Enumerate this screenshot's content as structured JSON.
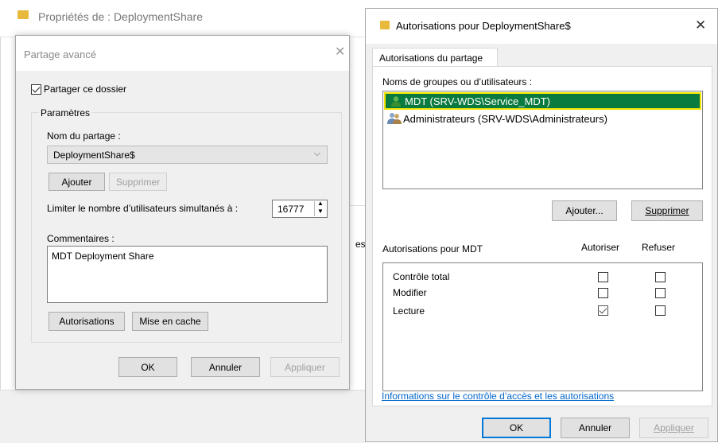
{
  "bg_window": {
    "title": "Propriétés de : DeploymentShare",
    "fragment_text": "es"
  },
  "advanced_share": {
    "title": "Partage avancé",
    "share_checkbox_label": "Partager ce dossier",
    "share_checked": true,
    "settings_group_label": "Paramètres",
    "share_name_label": "Nom du partage :",
    "share_name_value": "DeploymentShare$",
    "add_button": "Ajouter",
    "remove_button": "Supprimer",
    "limit_label": "Limiter le nombre d’utilisateurs simultanés à :",
    "limit_value": "16777",
    "comments_label": "Commentaires :",
    "comments_value": "MDT Deployment Share",
    "permissions_button": "Autorisations",
    "cache_button": "Mise en cache",
    "ok_button": "OK",
    "cancel_button": "Annuler",
    "apply_button": "Appliquer"
  },
  "permissions_dialog": {
    "title": "Autorisations pour DeploymentShare$",
    "close_glyph": "✕",
    "tab_label": "Autorisations du partage",
    "groups_label": "Noms de groupes ou d’utilisateurs :",
    "principals": [
      {
        "name": "MDT (SRV-WDS\\Service_MDT)",
        "icon": "user-icon",
        "selected": true
      },
      {
        "name": "Administrateurs (SRV-WDS\\Administrateurs)",
        "icon": "group-icon",
        "selected": false
      }
    ],
    "add_button": "Ajouter...",
    "remove_button": "Supprimer",
    "perms_for_label": "Autorisations pour MDT",
    "allow_header": "Autoriser",
    "deny_header": "Refuser",
    "permissions": [
      {
        "name": "Contrôle total",
        "allow": false,
        "deny": false
      },
      {
        "name": "Modifier",
        "allow": false,
        "deny": false
      },
      {
        "name": "Lecture",
        "allow": true,
        "deny": false
      }
    ],
    "info_link": "Informations sur le contrôle d’accès et les autorisations",
    "ok_button": "OK",
    "cancel_button": "Annuler",
    "apply_button": "Appliquer"
  },
  "colors": {
    "selection": "#0a7b3e",
    "selection_border": "#f5e400",
    "link": "#0066cc",
    "accent": "#0078d7"
  }
}
